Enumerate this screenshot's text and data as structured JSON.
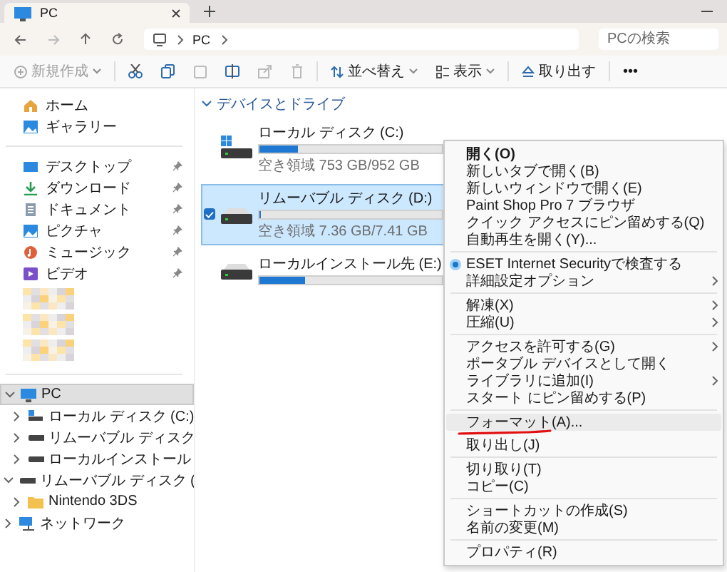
{
  "tab": {
    "title": "PC",
    "selected": true
  },
  "address": {
    "crumbs": [
      "PC"
    ]
  },
  "search": {
    "placeholder": "PCの検索"
  },
  "toolbar": {
    "new": "新規作成",
    "sort": "並べ替え",
    "view": "表示",
    "eject": "取り出す",
    "more": "•••"
  },
  "sidebar": {
    "top": [
      {
        "label": "ホーム"
      },
      {
        "label": "ギャラリー"
      }
    ],
    "quick": [
      {
        "label": "デスクトップ",
        "pinned": true
      },
      {
        "label": "ダウンロード",
        "pinned": true
      },
      {
        "label": "ドキュメント",
        "pinned": true
      },
      {
        "label": "ピクチャ",
        "pinned": true
      },
      {
        "label": "ミュージック",
        "pinned": true
      },
      {
        "label": "ビデオ",
        "pinned": true
      }
    ],
    "tree": [
      {
        "label": "PC",
        "expanded": true,
        "selected": true,
        "children": [
          {
            "label": "ローカル ディスク (C:)",
            "expanded": false,
            "selected": false
          },
          {
            "label": "リムーバブル ディスク",
            "expanded": false,
            "selected": false
          },
          {
            "label": "ローカルインストール",
            "expanded": false,
            "selected": false
          }
        ]
      },
      {
        "label": "リムーバブル ディスク (",
        "expanded": true,
        "selected": false,
        "children": [
          {
            "label": "Nintendo 3DS",
            "expanded": false,
            "selected": false
          }
        ]
      },
      {
        "label": "ネットワーク",
        "expanded": false,
        "selected": false
      }
    ]
  },
  "section": {
    "title": "デバイスとドライブ",
    "expanded": true
  },
  "drives": [
    {
      "name": "ローカル ディスク (C:)",
      "level": 0.21,
      "free": "空き領域 753 GB/952 GB",
      "selected": false,
      "checked": false
    },
    {
      "name": "リムーバブル ディスク (D:)",
      "level": 0.01,
      "free": "空き領域 7.36 GB/7.41 GB",
      "selected": true,
      "checked": true
    },
    {
      "name": "ローカルインストール先 (E:)",
      "level": 0.25,
      "selected": false,
      "checked": false
    }
  ],
  "context_menu": {
    "items": [
      {
        "kind": "item",
        "label": "開く(O)",
        "bold": true,
        "submenu": false,
        "selected": false,
        "underlined": false
      },
      {
        "kind": "item",
        "label": "新しいタブで開く(B)",
        "bold": false,
        "submenu": false,
        "selected": false,
        "underlined": false
      },
      {
        "kind": "item",
        "label": "新しいウィンドウで開く(E)",
        "bold": false,
        "submenu": false,
        "selected": false,
        "underlined": false
      },
      {
        "kind": "item",
        "label": "Paint Shop Pro 7 ブラウザ",
        "bold": false,
        "submenu": false,
        "selected": false,
        "underlined": false
      },
      {
        "kind": "item",
        "label": "クイック アクセスにピン留めする(Q)",
        "bold": false,
        "submenu": false,
        "selected": false,
        "underlined": false
      },
      {
        "kind": "item",
        "label": "自動再生を開く(Y)...",
        "bold": false,
        "submenu": false,
        "selected": false,
        "underlined": false
      },
      {
        "kind": "separator"
      },
      {
        "kind": "icon-item",
        "label": "ESET Internet Securityで検査する",
        "bold": false,
        "submenu": false,
        "selected": false,
        "underlined": false
      },
      {
        "kind": "item",
        "label": "詳細設定オプション",
        "bold": false,
        "submenu": true,
        "selected": false,
        "underlined": false
      },
      {
        "kind": "separator"
      },
      {
        "kind": "item",
        "label": "解凍(X)",
        "bold": false,
        "submenu": true,
        "selected": false,
        "underlined": false
      },
      {
        "kind": "item",
        "label": "圧縮(U)",
        "bold": false,
        "submenu": true,
        "selected": false,
        "underlined": false
      },
      {
        "kind": "separator"
      },
      {
        "kind": "item",
        "label": "アクセスを許可する(G)",
        "bold": false,
        "submenu": true,
        "selected": false,
        "underlined": false
      },
      {
        "kind": "item",
        "label": "ポータブル デバイスとして開く",
        "bold": false,
        "submenu": false,
        "selected": false,
        "underlined": false
      },
      {
        "kind": "item",
        "label": "ライブラリに追加(I)",
        "bold": false,
        "submenu": true,
        "selected": false,
        "underlined": false
      },
      {
        "kind": "item",
        "label": "スタート にピン留めする(P)",
        "bold": false,
        "submenu": false,
        "selected": false,
        "underlined": false
      },
      {
        "kind": "separator"
      },
      {
        "kind": "item",
        "label": "フォーマット(A)...",
        "bold": false,
        "submenu": false,
        "selected": true,
        "underlined": true
      },
      {
        "kind": "item",
        "label": "取り出し(J)",
        "bold": false,
        "submenu": false,
        "selected": false,
        "underlined": false
      },
      {
        "kind": "separator"
      },
      {
        "kind": "item",
        "label": "切り取り(T)",
        "bold": false,
        "submenu": false,
        "selected": false,
        "underlined": false
      },
      {
        "kind": "item",
        "label": "コピー(C)",
        "bold": false,
        "submenu": false,
        "selected": false,
        "underlined": false
      },
      {
        "kind": "separator"
      },
      {
        "kind": "item",
        "label": "ショートカットの作成(S)",
        "bold": false,
        "submenu": false,
        "selected": false,
        "underlined": false
      },
      {
        "kind": "item",
        "label": "名前の変更(M)",
        "bold": false,
        "submenu": false,
        "selected": false,
        "underlined": false
      },
      {
        "kind": "separator"
      },
      {
        "kind": "item",
        "label": "プロパティ(R)",
        "bold": false,
        "submenu": false,
        "selected": false,
        "underlined": false
      }
    ]
  }
}
